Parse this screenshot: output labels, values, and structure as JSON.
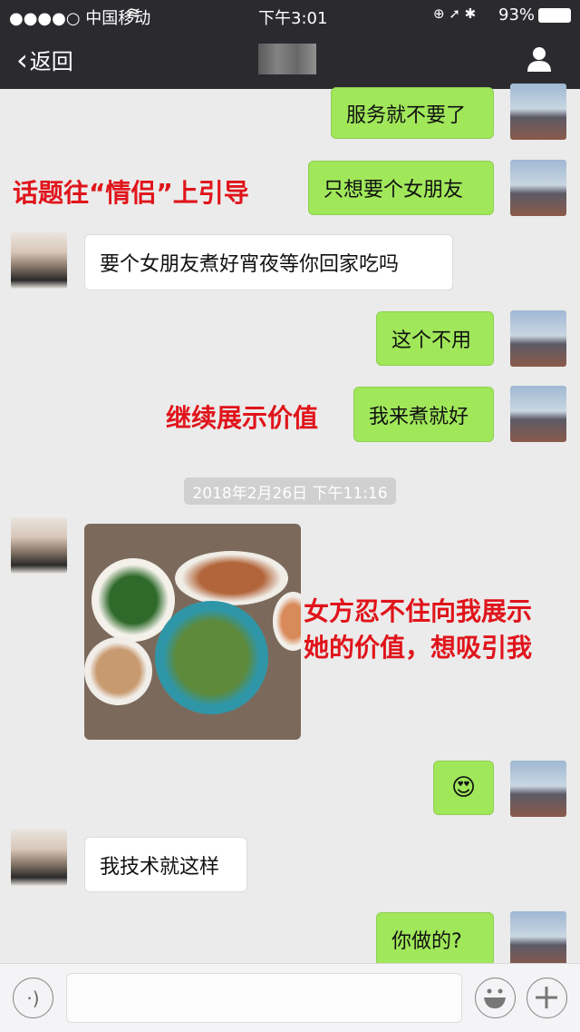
{
  "status_bar": {
    "carrier": "●●●●○ 中国移动",
    "time": "下午3:01",
    "battery": "93%"
  },
  "nav": {
    "back_label": "返回"
  },
  "messages": [
    {
      "side": "sent",
      "text": "服务就不要了"
    },
    {
      "side": "sent",
      "text": "只想要个女朋友"
    },
    {
      "side": "received",
      "text": "要个女朋友煮好宵夜等你回家吃吗"
    },
    {
      "side": "sent",
      "text": "这个不用"
    },
    {
      "side": "sent",
      "text": "我来煮就好"
    },
    {
      "side": "received",
      "type": "image"
    },
    {
      "side": "sent",
      "type": "emoji"
    },
    {
      "side": "received",
      "text": "我技术就这样"
    },
    {
      "side": "sent",
      "text": "你做的?"
    }
  ],
  "timestamp": "2018年2月26日 下午11:16",
  "annotations": {
    "a1": "话题往“情侣”上引导",
    "a2": "继续展示价值",
    "a3_line1": "女方忍不住向我展示",
    "a3_line2": "她的价值，想吸引我"
  },
  "colors": {
    "sent_bubble": "#a0e75a",
    "annotation": "#e0141b",
    "nav": "#2b2b2f"
  }
}
